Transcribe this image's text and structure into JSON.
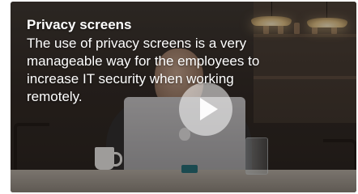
{
  "video": {
    "title": "Privacy screens",
    "description": "The use of privacy screens is a very manageable way for the employees to increase IT security when working remotely.",
    "play_icon": "play-icon"
  }
}
